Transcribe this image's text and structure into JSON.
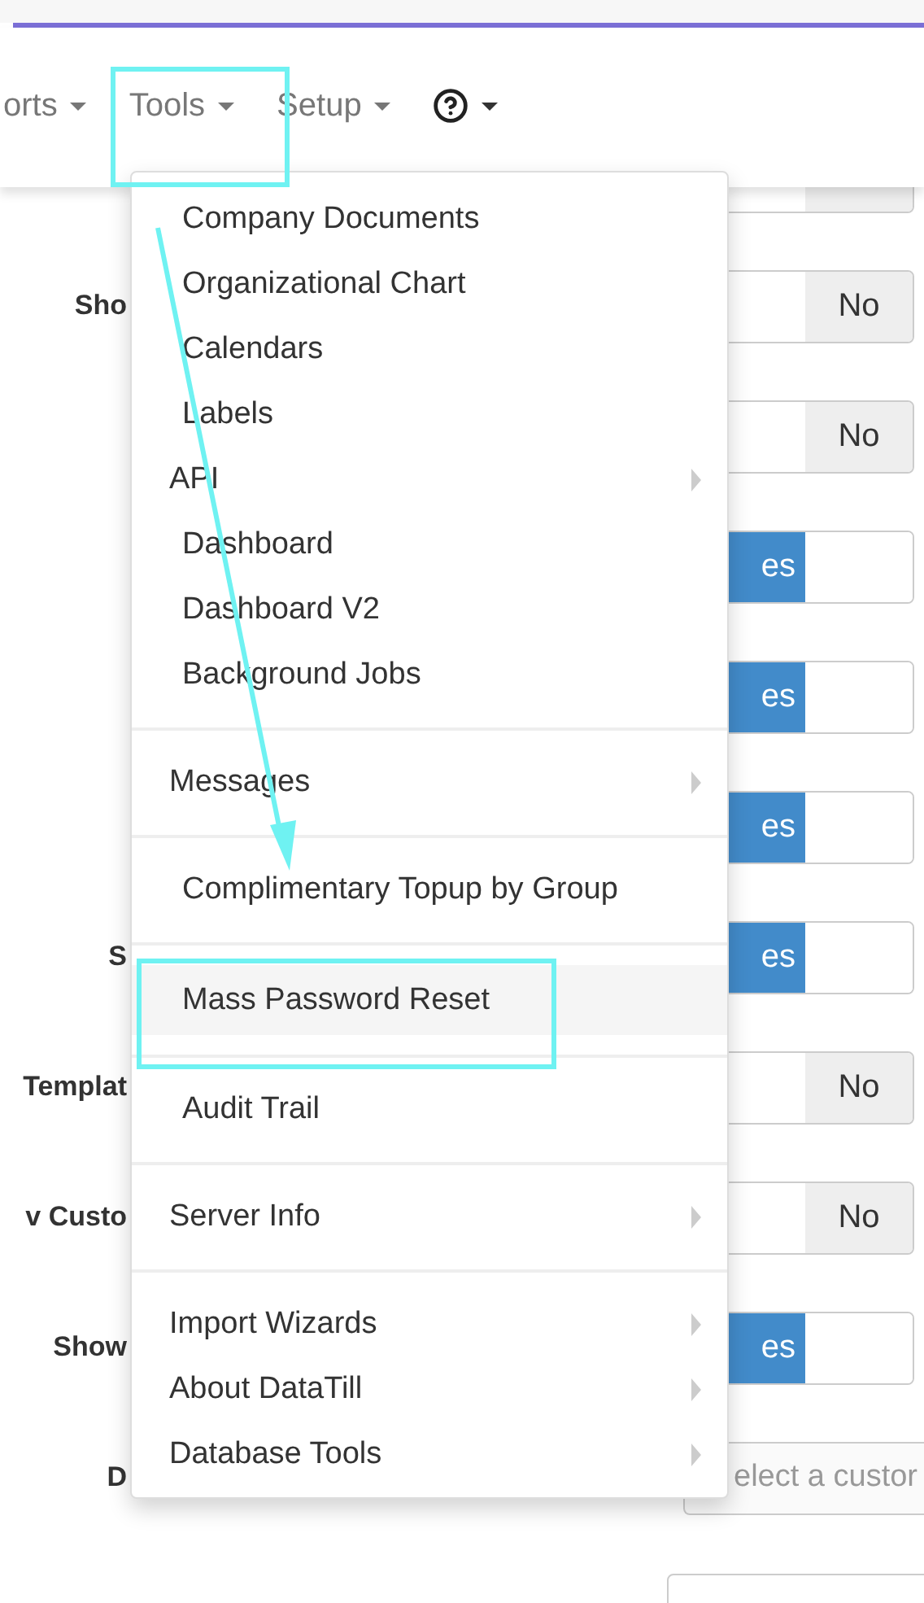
{
  "navbar": {
    "items": [
      {
        "kind": "text",
        "label": "orts"
      },
      {
        "kind": "text",
        "label": "Tools"
      },
      {
        "kind": "text",
        "label": "Setup"
      },
      {
        "kind": "help"
      }
    ]
  },
  "form_rows": [
    {
      "kind": "switch",
      "switch": {
        "on": false
      }
    },
    {
      "kind": "switch",
      "label": "Sho",
      "switch": {
        "on": false,
        "text": "No"
      }
    },
    {
      "kind": "switch",
      "switch": {
        "on": false,
        "text": "No"
      }
    },
    {
      "kind": "switch",
      "switch": {
        "on": true,
        "text": "es"
      }
    },
    {
      "kind": "switch",
      "switch": {
        "on": true,
        "text": "es"
      }
    },
    {
      "kind": "switch",
      "switch": {
        "on": true,
        "text": "es"
      }
    },
    {
      "kind": "switch",
      "label": "S",
      "switch": {
        "on": true,
        "text": "es"
      }
    },
    {
      "kind": "switch",
      "label": "Templat",
      "switch": {
        "on": false,
        "text": "No"
      }
    },
    {
      "kind": "switch",
      "label": "v Custo",
      "switch": {
        "on": false,
        "text": "No"
      }
    },
    {
      "kind": "switch",
      "label": "Show",
      "switch": {
        "on": true,
        "text": "es"
      }
    },
    {
      "kind": "select",
      "label": "D",
      "placeholder": "elect a custor"
    }
  ],
  "tools_menu": {
    "sections": [
      {
        "items": [
          {
            "label": "Company Documents",
            "submenu": false,
            "selected": false
          },
          {
            "label": "Organizational Chart",
            "submenu": false,
            "selected": false
          },
          {
            "label": "Calendars",
            "submenu": false,
            "selected": false
          },
          {
            "label": "Labels",
            "submenu": false,
            "selected": false
          },
          {
            "label": "API",
            "submenu": true,
            "selected": false
          },
          {
            "label": "Dashboard",
            "submenu": false,
            "selected": false
          },
          {
            "label": "Dashboard V2",
            "submenu": false,
            "selected": false
          },
          {
            "label": "Background Jobs",
            "submenu": false,
            "selected": false
          }
        ]
      },
      {
        "items": [
          {
            "label": "Messages",
            "submenu": true,
            "selected": false
          }
        ]
      },
      {
        "items": [
          {
            "label": "Complimentary Topup by Group",
            "submenu": false,
            "selected": false
          }
        ]
      },
      {
        "items": [
          {
            "label": "Mass Password Reset",
            "submenu": false,
            "selected": true
          }
        ]
      },
      {
        "items": [
          {
            "label": "Audit Trail",
            "submenu": false,
            "selected": false
          }
        ]
      },
      {
        "items": [
          {
            "label": "Server Info",
            "submenu": true,
            "selected": false
          }
        ]
      },
      {
        "items": [
          {
            "label": "Import Wizards",
            "submenu": true,
            "selected": false
          },
          {
            "label": "About DataTill",
            "submenu": true,
            "selected": false
          },
          {
            "label": "Database Tools",
            "submenu": true,
            "selected": false
          }
        ]
      }
    ]
  }
}
